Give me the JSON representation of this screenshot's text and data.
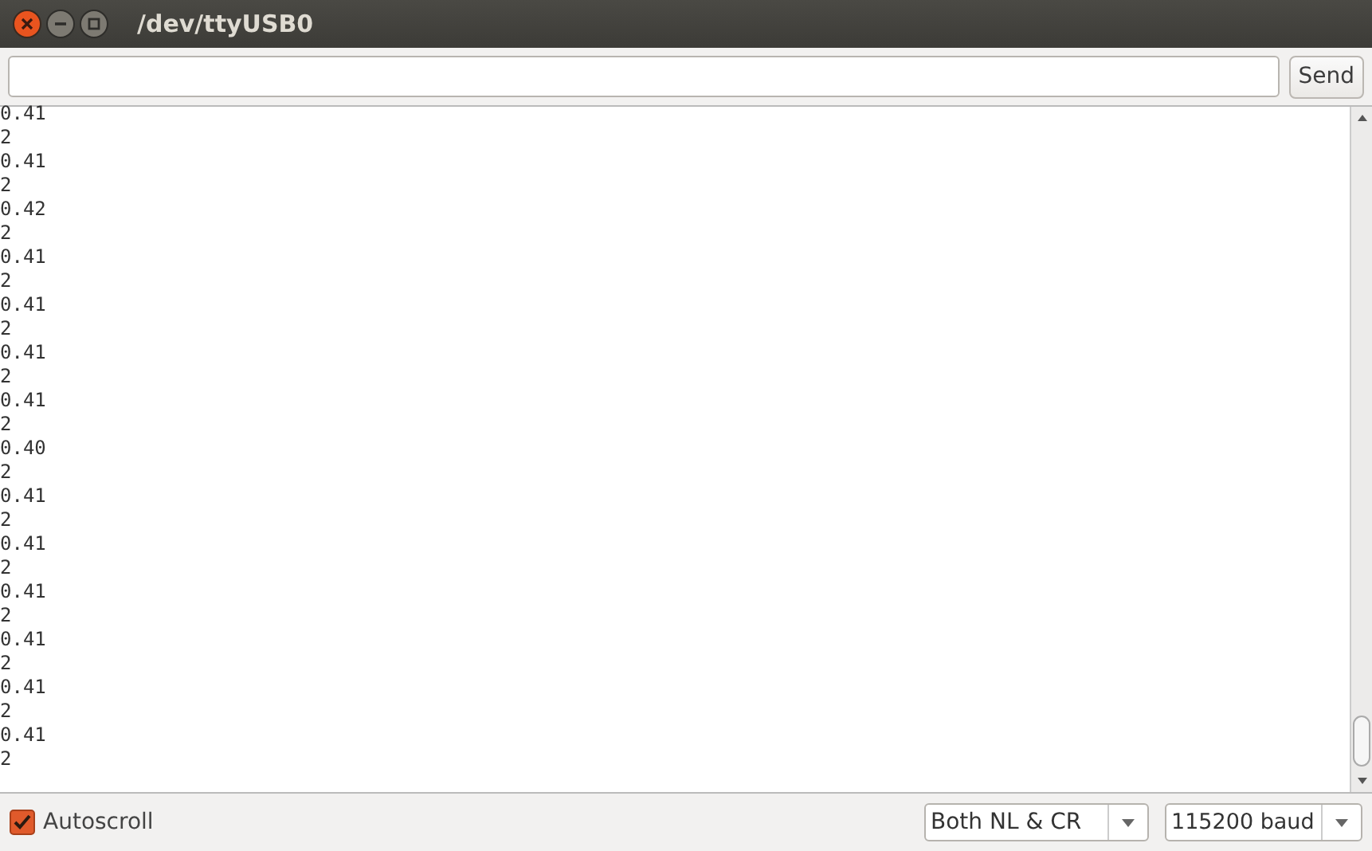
{
  "window": {
    "title": "/dev/ttyUSB0"
  },
  "send_button": "Send",
  "output_lines": [
    "0.41",
    "2",
    "0.41",
    "2",
    "0.42",
    "2",
    "0.41",
    "2",
    "0.41",
    "2",
    "0.41",
    "2",
    "0.41",
    "2",
    "0.40",
    "2",
    "0.41",
    "2",
    "0.41",
    "2",
    "0.41",
    "2",
    "0.41",
    "2",
    "0.41",
    "2",
    "0.41",
    "2"
  ],
  "autoscroll": {
    "label": "Autoscroll",
    "checked": true
  },
  "line_ending": {
    "value": "Both NL & CR"
  },
  "baud_rate": {
    "value": "115200 baud"
  }
}
